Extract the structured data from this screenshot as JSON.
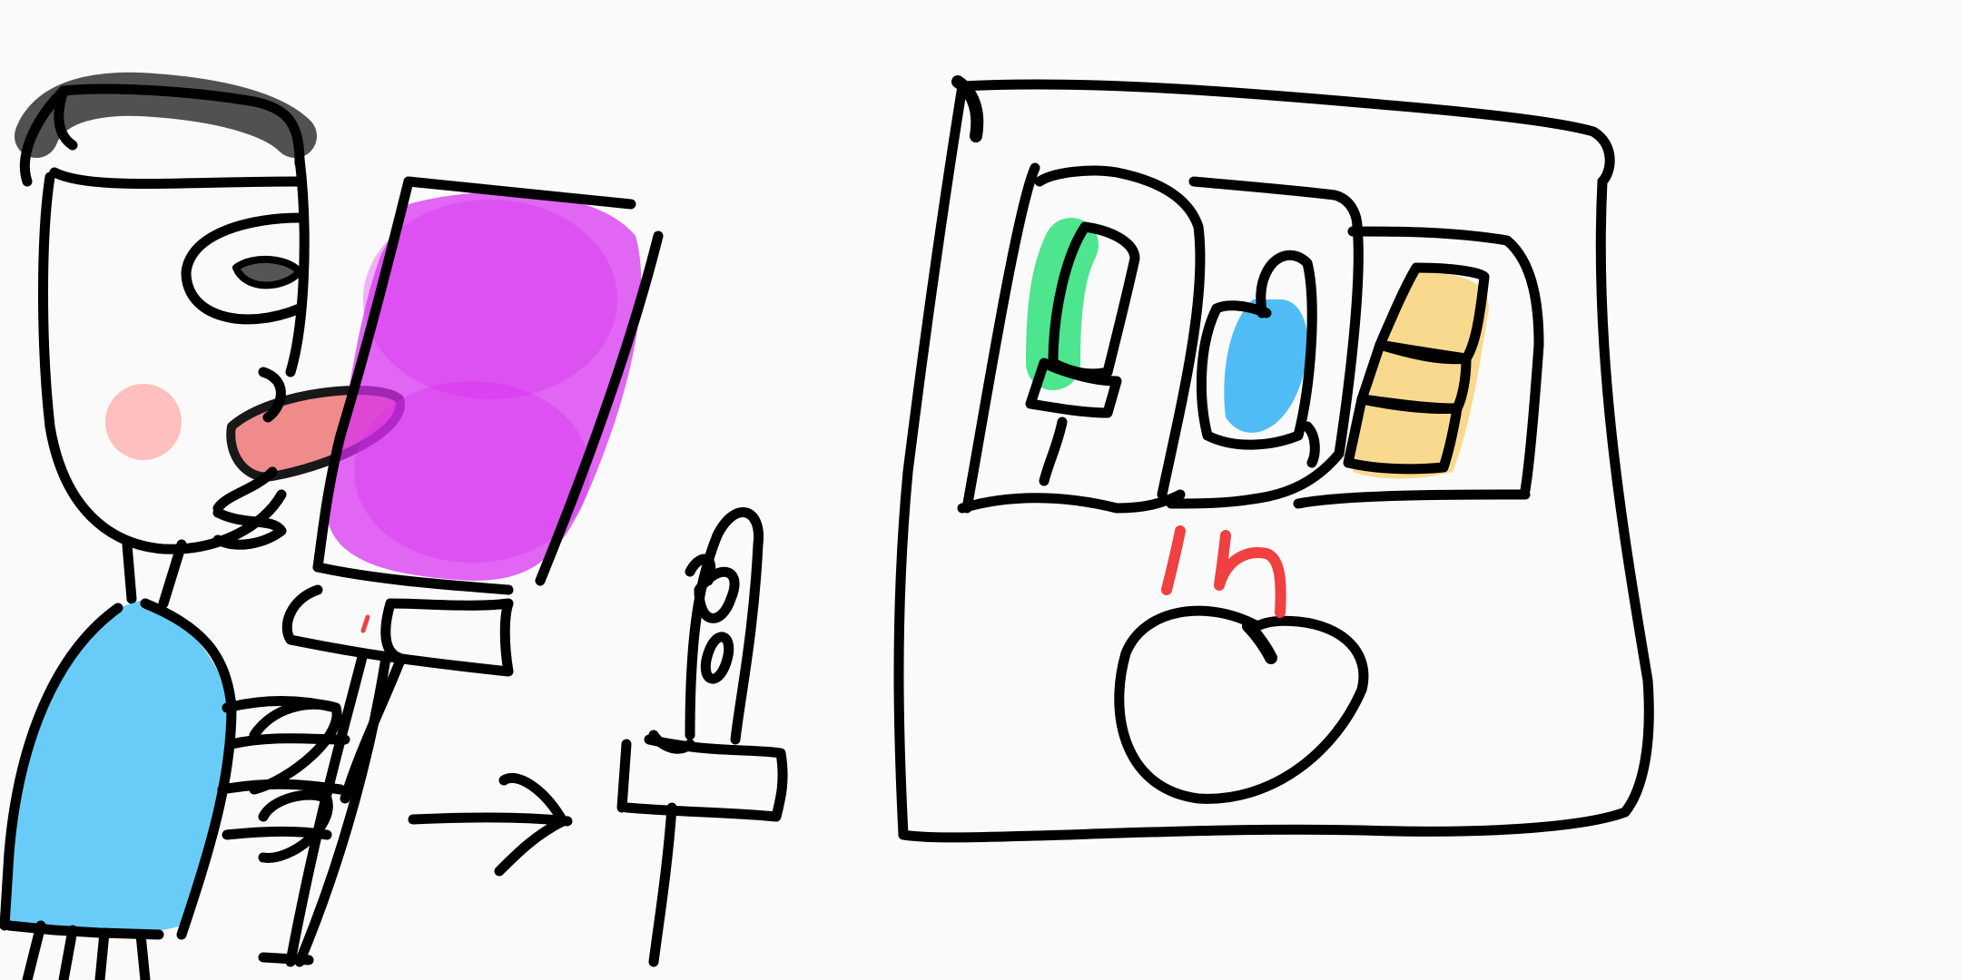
{
  "scene": {
    "background_color": "#fafafa",
    "ink_color": "#000000",
    "colors": {
      "hair": "#333333",
      "cheek": "#ffb4b4",
      "nose": "#f08080",
      "canvas_paint": "#d62cf0",
      "shirt": "#4fc3f7",
      "paint_green": "#2ee07a",
      "paint_blue": "#3db5f5",
      "paint_yellow": "#f8d27a",
      "stem_red": "#f04040"
    },
    "elements": [
      "painter-figure",
      "easel-with-canvas",
      "arrow-icon",
      "small-easel-icon",
      "paint-palette-frame",
      "paint-tube-icon",
      "paint-blob-icon",
      "paint-sponge-icon",
      "apple-icon"
    ]
  }
}
